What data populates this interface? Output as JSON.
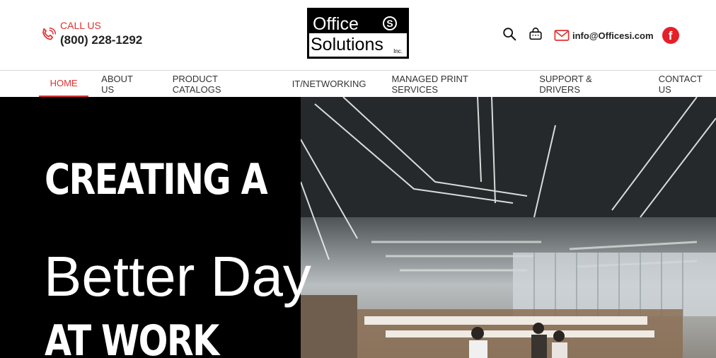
{
  "header": {
    "call_label": "CALL US",
    "phone": "(800) 228-1292",
    "email": "info@Officesi.com",
    "facebook_glyph": "f",
    "accent_color": "#e03131"
  },
  "logo": {
    "word1": "Office",
    "word2": "Solutions",
    "badge": "S",
    "suffix": "Inc."
  },
  "nav": {
    "items": [
      {
        "label": "HOME",
        "active": true
      },
      {
        "label": "ABOUT US"
      },
      {
        "label": "PRODUCT CATALOGS"
      },
      {
        "label": "IT/NETWORKING"
      },
      {
        "label": "MANAGED PRINT SERVICES"
      },
      {
        "label": "SUPPORT & DRIVERS"
      },
      {
        "label": "CONTACT US"
      }
    ]
  },
  "hero": {
    "line1": "CREATING A",
    "line2": "Better Day",
    "line3": "AT WORK",
    "image_icon": "office-interior-photo"
  },
  "icons": [
    "phone-icon",
    "search-icon",
    "shopping-bag-icon",
    "mail-icon",
    "facebook-icon"
  ]
}
